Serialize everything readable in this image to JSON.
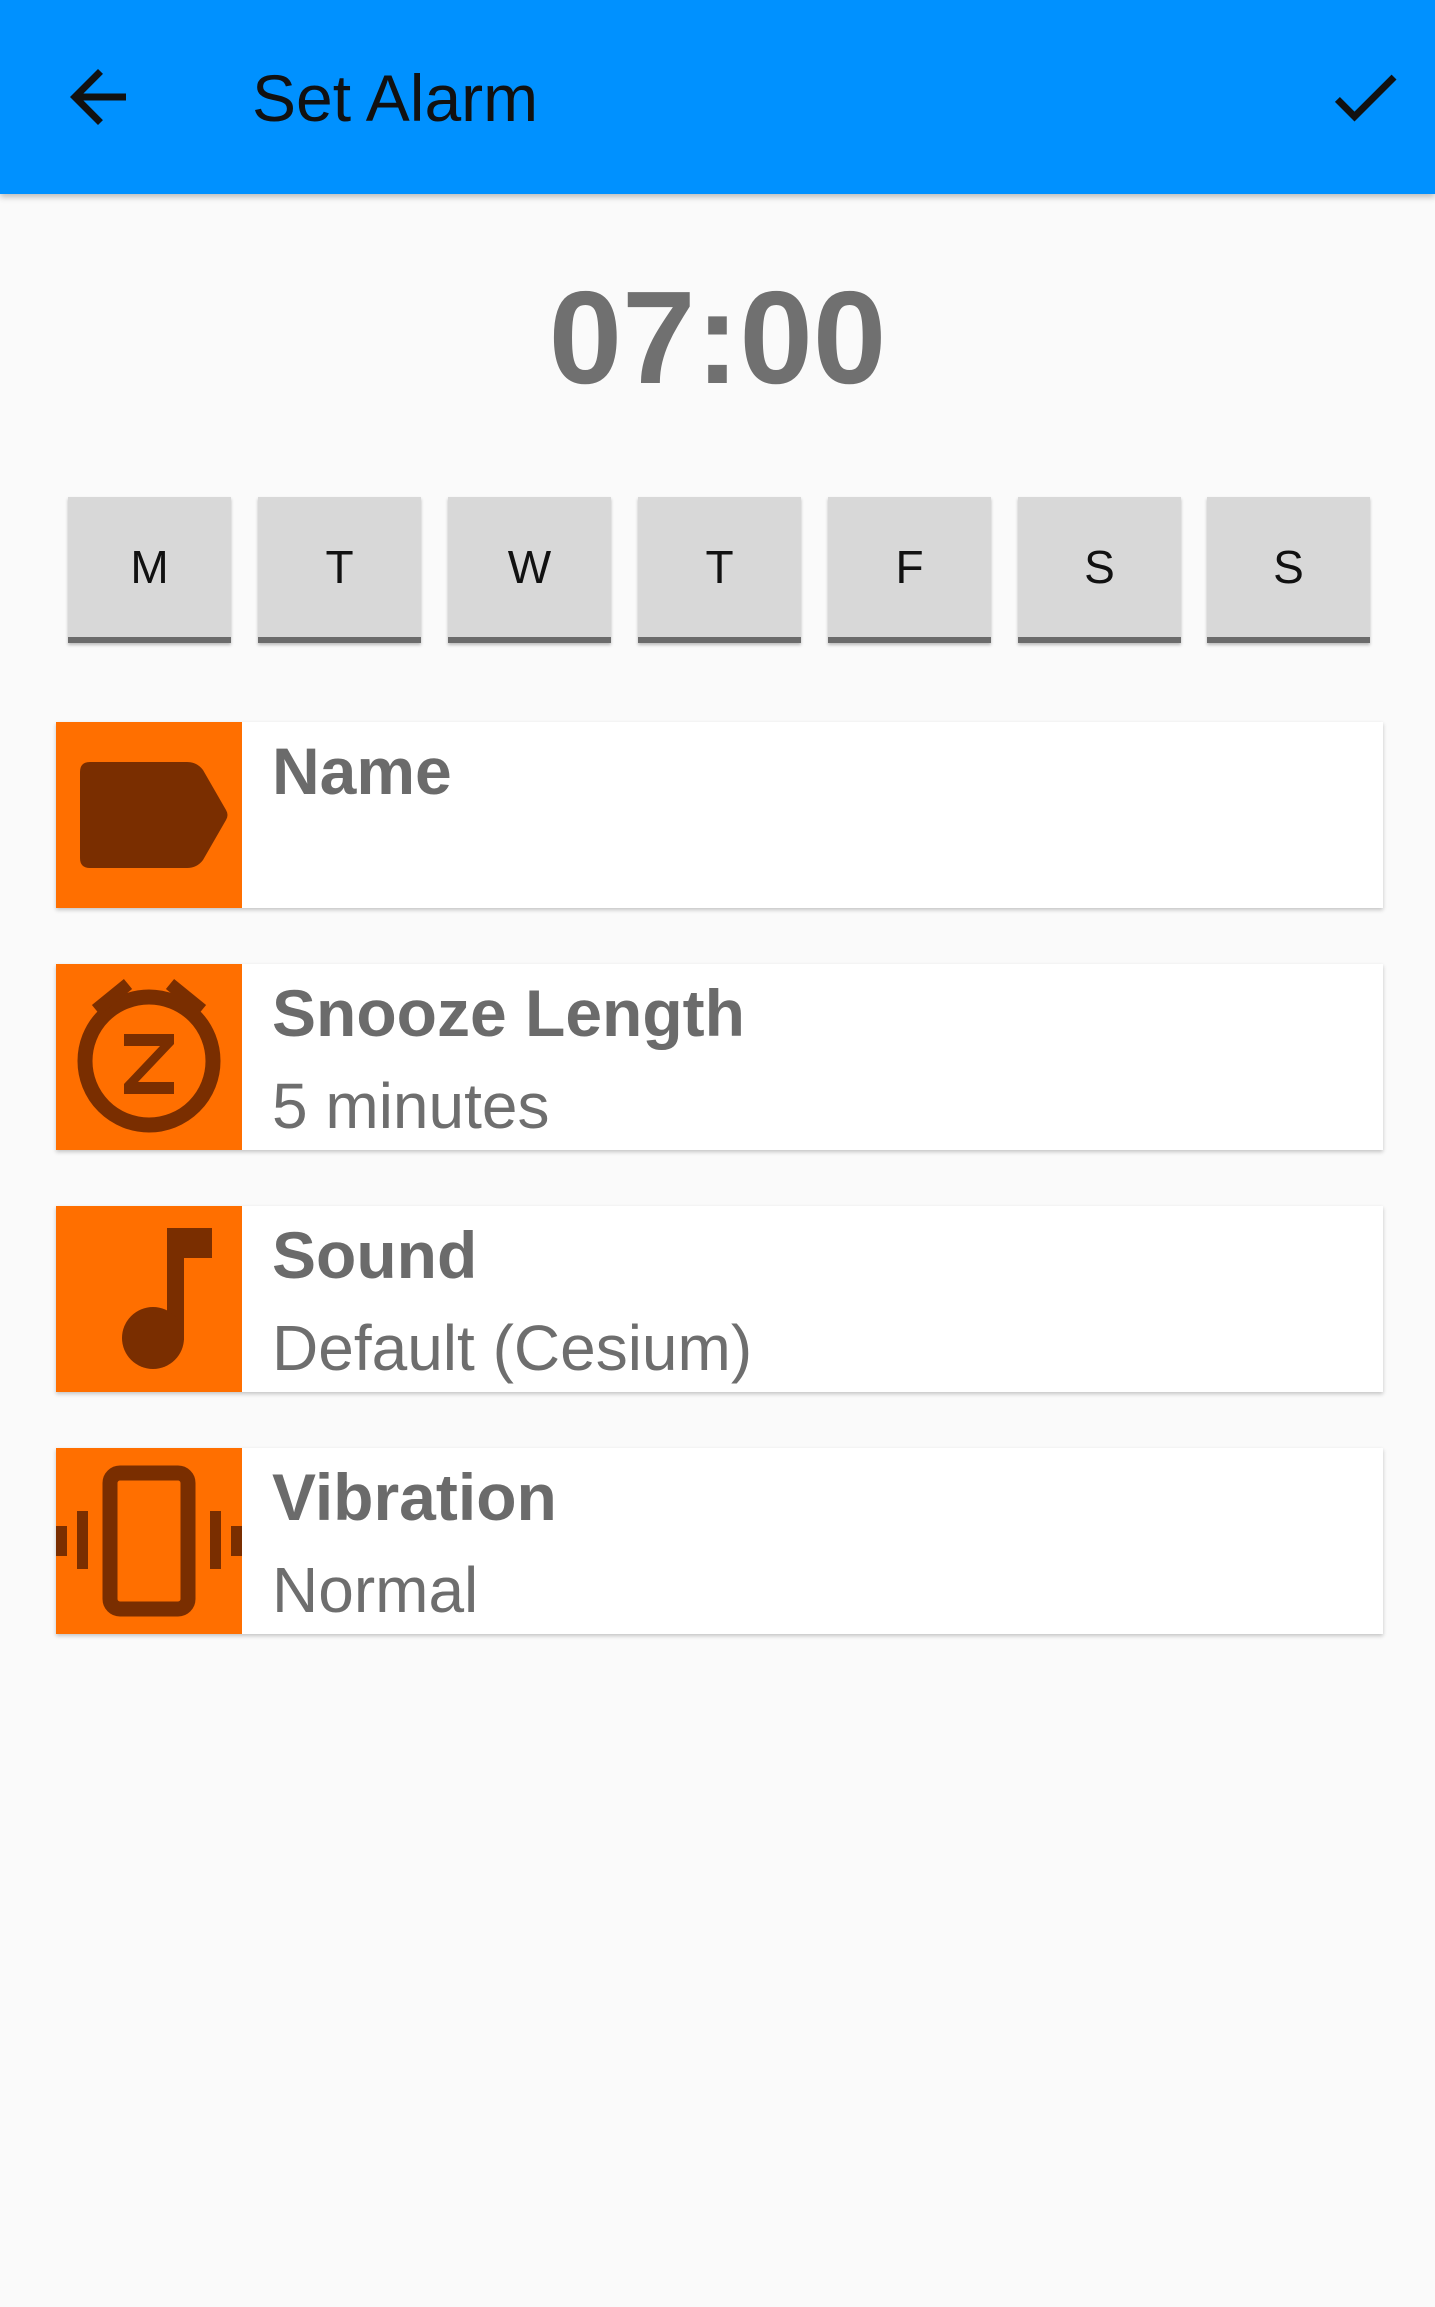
{
  "appbar": {
    "title": "Set Alarm",
    "back_icon": "arrow-back-icon",
    "confirm_icon": "check-icon",
    "color": "#0091ff"
  },
  "alarm": {
    "time": "07:00"
  },
  "days": [
    "M",
    "T",
    "W",
    "T",
    "F",
    "S",
    "S"
  ],
  "settings": {
    "name": {
      "label": "Name",
      "value": "",
      "icon": "label-tag-icon"
    },
    "snooze": {
      "label": "Snooze Length",
      "value": "5 minutes",
      "icon": "snooze-icon"
    },
    "sound": {
      "label": "Sound",
      "value": "Default (Cesium)",
      "icon": "music-note-icon"
    },
    "vibration": {
      "label": "Vibration",
      "value": "Normal",
      "icon": "vibration-icon"
    }
  },
  "colors": {
    "accent": "#ff6f00",
    "icon_fill": "#7a2e00"
  }
}
